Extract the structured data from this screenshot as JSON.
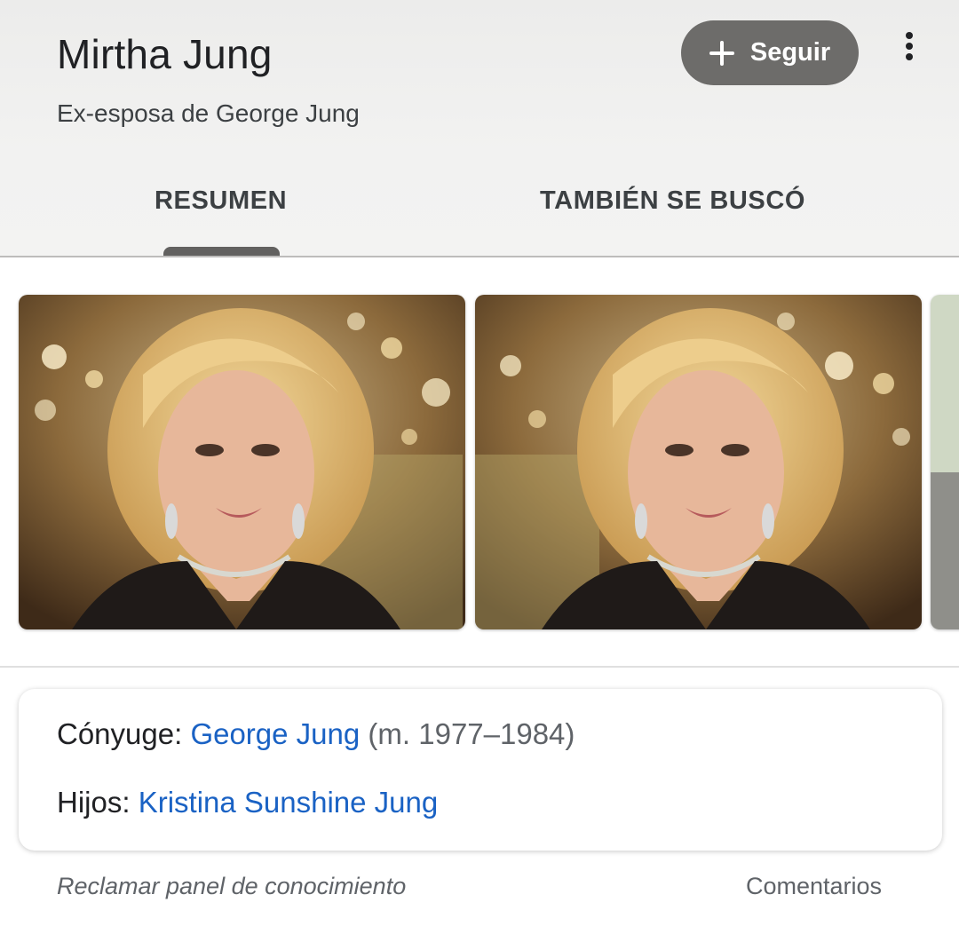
{
  "header": {
    "title": "Mirtha Jung",
    "subtitle": "Ex-esposa de George Jung",
    "follow_label": "Seguir",
    "follow_icon": "plus-icon",
    "menu_icon": "more-vert-icon"
  },
  "tabs": [
    {
      "label": "RESUMEN",
      "selected": true
    },
    {
      "label": "TAMBIÉN SE BUSCÓ",
      "selected": false
    }
  ],
  "gallery": {
    "images": [
      {
        "label": "portrait-photo"
      },
      {
        "label": "portrait-photo"
      },
      {
        "label": "partial-photo"
      }
    ]
  },
  "facts": {
    "spouse": {
      "label": "Cónyuge:",
      "name": "George Jung",
      "detail": "(m. 1977–1984)"
    },
    "children": {
      "label": "Hijos:",
      "name": "Kristina Sunshine Jung"
    }
  },
  "footer": {
    "claim": "Reclamar panel de conocimiento",
    "feedback": "Comentarios"
  },
  "colors": {
    "link": "#1a62c4",
    "button_bg": "#6d6c6a",
    "header_bg": "#efefee"
  }
}
